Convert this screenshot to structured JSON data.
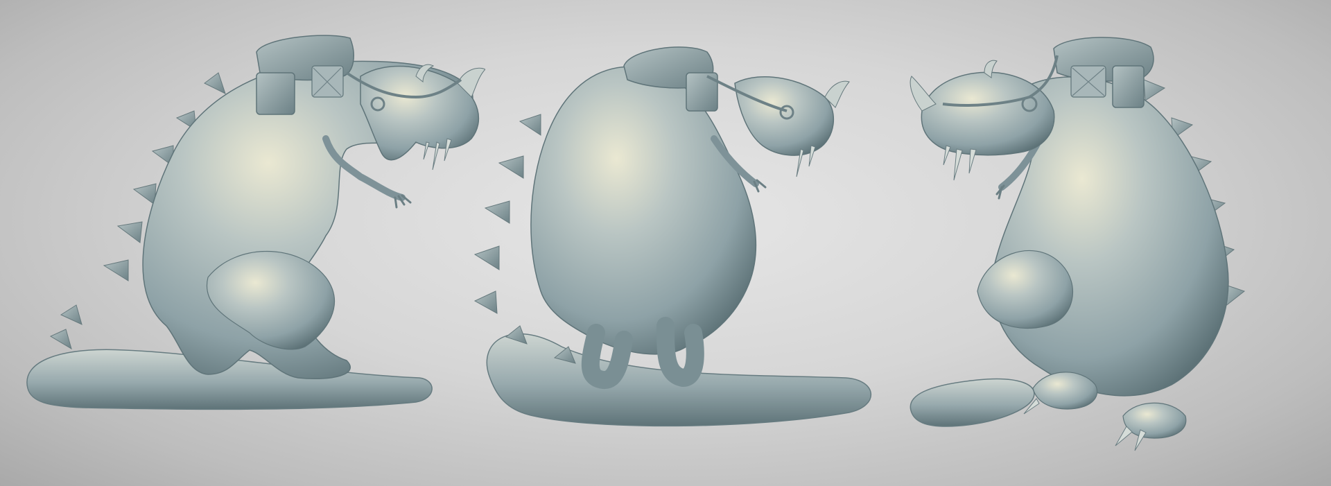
{
  "scene": {
    "background_colors": [
      "#e6e6e6",
      "#bdbdbd",
      "#a9a9a9"
    ],
    "model_color": "#9fb1b4",
    "model_highlight": "#e3e2cc",
    "model_shadow": "#5f7479"
  },
  "views": [
    {
      "name": "side-view-facing-right"
    },
    {
      "name": "back-three-quarter-view"
    },
    {
      "name": "front-three-quarter-view-facing-left"
    }
  ]
}
